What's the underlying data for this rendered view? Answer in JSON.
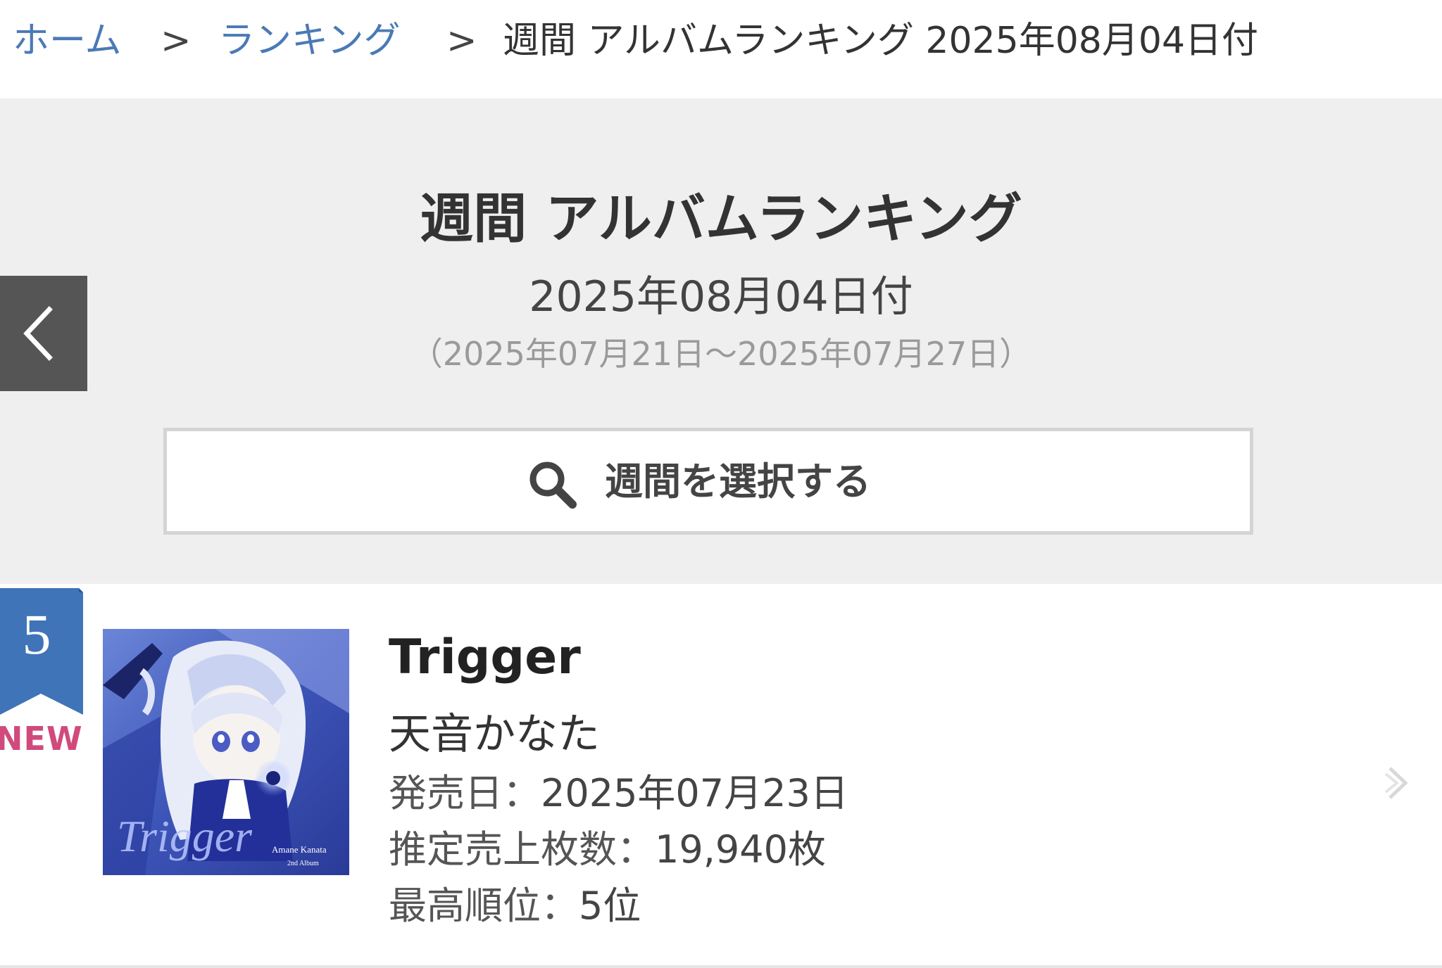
{
  "breadcrumb": {
    "home": "ホーム",
    "separator": ">",
    "ranking": "ランキング",
    "current": "週間 アルバムランキング 2025年08月04日付"
  },
  "header": {
    "title": "週間 アルバムランキング",
    "date": "2025年08月04日付",
    "range": "（2025年07月21日～2025年07月27日）",
    "select_week_label": "週間を選択する",
    "prev_icon": "chevron-left-icon",
    "search_icon": "search-icon"
  },
  "ranking": [
    {
      "rank": "5",
      "status": "NEW",
      "title": "Trigger",
      "artist": "天音かなた",
      "release_date_label": "発売日：",
      "release_date": "2025年07月23日",
      "sales_label": "推定売上枚数：",
      "sales": "19,940枚",
      "peak_label": "最高順位：",
      "peak": "5位",
      "cover_text": "Trigger",
      "cover_subtext": "Amane Kanata",
      "cover_subtext2": "2nd Album"
    }
  ],
  "colors": {
    "link": "#4a7ab5",
    "panel_bg": "#efefef",
    "prev_button_bg": "#555555",
    "badge_blue": "#3f74b8",
    "new_pink": "#d04a7c"
  }
}
